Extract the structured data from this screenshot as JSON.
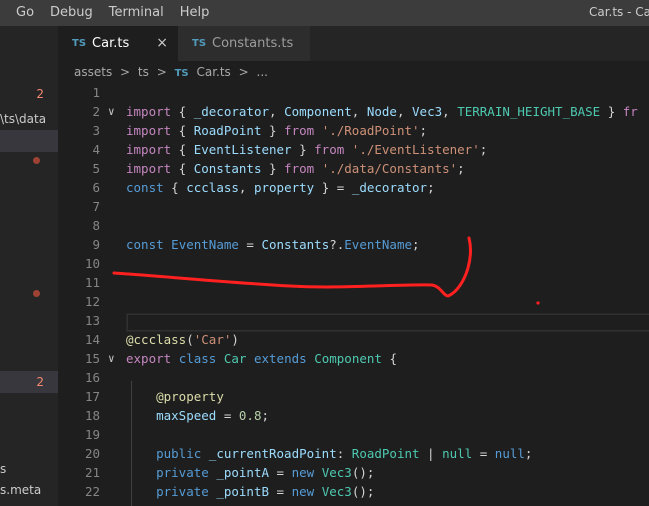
{
  "menu": [
    "Go",
    "Debug",
    "Terminal",
    "Help"
  ],
  "window_title": "Car.ts - Ca",
  "sidebar": {
    "badges": [
      "2",
      "2"
    ],
    "path_fragment": "\\ts\\data",
    "file_s": "s",
    "file_meta": "s.meta"
  },
  "tabs": [
    {
      "icon": "TS",
      "label": "Car.ts",
      "close": "×"
    },
    {
      "icon": "TS",
      "label": "Constants.ts"
    }
  ],
  "breadcrumb": {
    "parts": [
      "assets",
      "ts",
      "Car.ts",
      "..."
    ],
    "ts_icon": "TS",
    "separator": ">"
  },
  "code_lines": [
    {
      "n": "1",
      "fold": false,
      "tokens": []
    },
    {
      "n": "2",
      "fold": true,
      "tokens": [
        [
          "c",
          "import"
        ],
        [
          "p",
          " { "
        ],
        [
          "v",
          "_decorator"
        ],
        [
          "p",
          ", "
        ],
        [
          "v",
          "Component"
        ],
        [
          "p",
          ", "
        ],
        [
          "v",
          "Node"
        ],
        [
          "p",
          ", "
        ],
        [
          "v",
          "Vec3"
        ],
        [
          "p",
          ", "
        ],
        [
          "t",
          "TERRAIN_HEIGHT_BASE"
        ],
        [
          "p",
          " } "
        ],
        [
          "c",
          "fr"
        ]
      ]
    },
    {
      "n": "3",
      "fold": false,
      "tokens": [
        [
          "c",
          "import"
        ],
        [
          "p",
          " { "
        ],
        [
          "v",
          "RoadPoint"
        ],
        [
          "p",
          " } "
        ],
        [
          "c",
          "from"
        ],
        [
          "p",
          " "
        ],
        [
          "s",
          "'./RoadPoint'"
        ],
        [
          "p",
          ";"
        ]
      ]
    },
    {
      "n": "4",
      "fold": false,
      "tokens": [
        [
          "c",
          "import"
        ],
        [
          "p",
          " { "
        ],
        [
          "v",
          "EventListener"
        ],
        [
          "p",
          " } "
        ],
        [
          "c",
          "from"
        ],
        [
          "p",
          " "
        ],
        [
          "s",
          "'./EventListener'"
        ],
        [
          "p",
          ";"
        ]
      ]
    },
    {
      "n": "5",
      "fold": false,
      "tokens": [
        [
          "c",
          "import"
        ],
        [
          "p",
          " { "
        ],
        [
          "v",
          "Constants"
        ],
        [
          "p",
          " } "
        ],
        [
          "c",
          "from"
        ],
        [
          "p",
          " "
        ],
        [
          "s",
          "'./data/Constants'"
        ],
        [
          "p",
          ";"
        ]
      ]
    },
    {
      "n": "6",
      "fold": false,
      "tokens": [
        [
          "k",
          "const"
        ],
        [
          "p",
          " { "
        ],
        [
          "v",
          "ccclass"
        ],
        [
          "p",
          ", "
        ],
        [
          "v",
          "property"
        ],
        [
          "p",
          " } = "
        ],
        [
          "v",
          "_decorator"
        ],
        [
          "p",
          ";"
        ]
      ]
    },
    {
      "n": "7",
      "fold": false,
      "tokens": []
    },
    {
      "n": "8",
      "fold": false,
      "tokens": []
    },
    {
      "n": "9",
      "fold": false,
      "tokens": [
        [
          "k",
          "const"
        ],
        [
          "p",
          " "
        ],
        [
          "k",
          "EventName"
        ],
        [
          "p",
          " = "
        ],
        [
          "v",
          "Constants"
        ],
        [
          "p",
          "?."
        ],
        [
          "k",
          "EventName"
        ],
        [
          "p",
          ";"
        ]
      ]
    },
    {
      "n": "10",
      "fold": false,
      "tokens": []
    },
    {
      "n": "11",
      "fold": false,
      "tokens": []
    },
    {
      "n": "12",
      "fold": false,
      "tokens": []
    },
    {
      "n": "13",
      "fold": false,
      "tokens": []
    },
    {
      "n": "14",
      "fold": false,
      "tokens": [
        [
          "f",
          "@ccclass"
        ],
        [
          "p",
          "("
        ],
        [
          "s",
          "'Car'"
        ],
        [
          "p",
          ")"
        ]
      ]
    },
    {
      "n": "15",
      "fold": true,
      "tokens": [
        [
          "c",
          "export"
        ],
        [
          "p",
          " "
        ],
        [
          "k",
          "class"
        ],
        [
          "p",
          " "
        ],
        [
          "t",
          "Car"
        ],
        [
          "p",
          " "
        ],
        [
          "k",
          "extends"
        ],
        [
          "p",
          " "
        ],
        [
          "t",
          "Component"
        ],
        [
          "p",
          " {"
        ]
      ]
    },
    {
      "n": "16",
      "fold": false,
      "tokens": []
    },
    {
      "n": "17",
      "fold": false,
      "tokens": [
        [
          "p",
          "    "
        ],
        [
          "f",
          "@property"
        ]
      ]
    },
    {
      "n": "18",
      "fold": false,
      "tokens": [
        [
          "p",
          "    "
        ],
        [
          "v",
          "maxSpeed"
        ],
        [
          "p",
          " = "
        ],
        [
          "n",
          "0.8"
        ],
        [
          "p",
          ";"
        ]
      ]
    },
    {
      "n": "19",
      "fold": false,
      "tokens": []
    },
    {
      "n": "20",
      "fold": false,
      "tokens": [
        [
          "p",
          "    "
        ],
        [
          "k",
          "public"
        ],
        [
          "p",
          " "
        ],
        [
          "v",
          "_currentRoadPoint"
        ],
        [
          "p",
          ": "
        ],
        [
          "t",
          "RoadPoint"
        ],
        [
          "p",
          " | "
        ],
        [
          "t",
          "null"
        ],
        [
          "p",
          " = "
        ],
        [
          "k",
          "null"
        ],
        [
          "p",
          ";"
        ]
      ]
    },
    {
      "n": "21",
      "fold": false,
      "tokens": [
        [
          "p",
          "    "
        ],
        [
          "k",
          "private"
        ],
        [
          "p",
          " "
        ],
        [
          "v",
          "_pointA"
        ],
        [
          "p",
          " = "
        ],
        [
          "k",
          "new"
        ],
        [
          "p",
          " "
        ],
        [
          "t",
          "Vec3"
        ],
        [
          "p",
          "();"
        ]
      ]
    },
    {
      "n": "22",
      "fold": false,
      "tokens": [
        [
          "p",
          "    "
        ],
        [
          "k",
          "private"
        ],
        [
          "p",
          " "
        ],
        [
          "v",
          "_pointB"
        ],
        [
          "p",
          " = "
        ],
        [
          "k",
          "new"
        ],
        [
          "p",
          " "
        ],
        [
          "t",
          "Vec3"
        ],
        [
          "p",
          "();"
        ]
      ]
    }
  ],
  "colors": {
    "annotation": "#ff2020",
    "keyword": "#569cd6",
    "control": "#c586c0",
    "string": "#ce9178",
    "variable": "#9cdcfe",
    "type": "#4ec9b0",
    "decorator": "#dcdcaa",
    "number": "#b5cea8"
  }
}
